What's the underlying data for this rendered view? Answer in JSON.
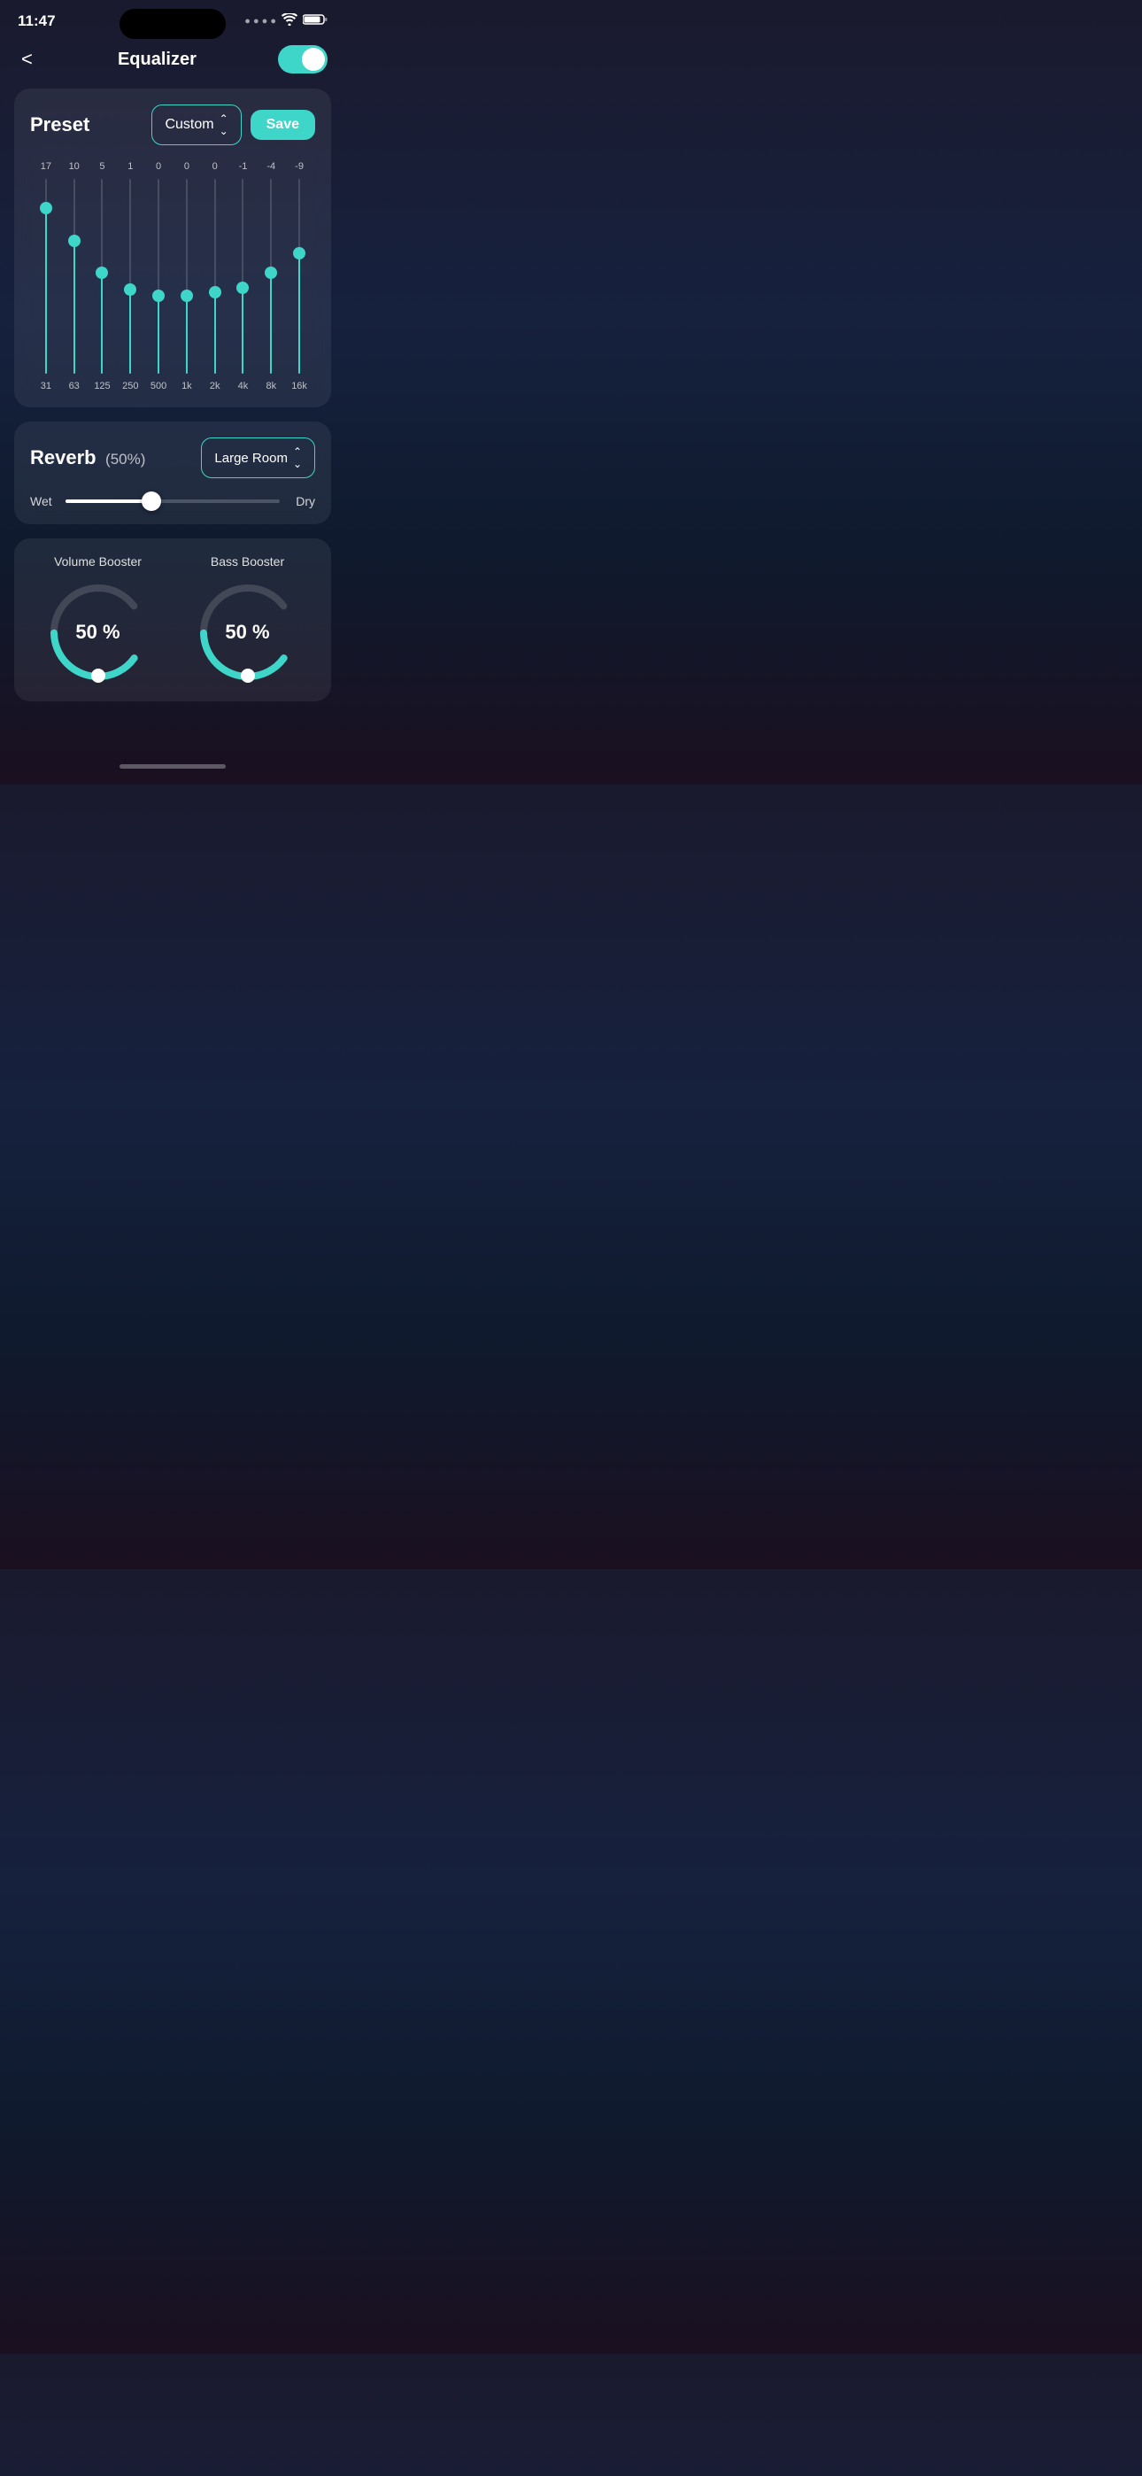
{
  "statusBar": {
    "time": "11:47",
    "signal": "····",
    "wifi": "wifi",
    "battery": "battery"
  },
  "header": {
    "backLabel": "<",
    "title": "Equalizer",
    "toggleOn": true
  },
  "preset": {
    "label": "Preset",
    "dropdownLabel": "Custom",
    "dropdownArrow": "⌃",
    "saveLabel": "Save"
  },
  "eq": {
    "bands": [
      {
        "freq": "31",
        "value": "17",
        "heightPct": 85,
        "thumbPct": 15
      },
      {
        "freq": "63",
        "value": "10",
        "heightPct": 68,
        "thumbPct": 32
      },
      {
        "freq": "125",
        "value": "5",
        "heightPct": 52,
        "thumbPct": 48
      },
      {
        "freq": "250",
        "value": "1",
        "heightPct": 43,
        "thumbPct": 57
      },
      {
        "freq": "500",
        "value": "0",
        "heightPct": 40,
        "thumbPct": 60
      },
      {
        "freq": "1k",
        "value": "0",
        "heightPct": 40,
        "thumbPct": 60
      },
      {
        "freq": "2k",
        "value": "0",
        "heightPct": 42,
        "thumbPct": 58
      },
      {
        "freq": "4k",
        "value": "-1",
        "heightPct": 44,
        "thumbPct": 56
      },
      {
        "freq": "8k",
        "value": "-4",
        "heightPct": 52,
        "thumbPct": 48
      },
      {
        "freq": "16k",
        "value": "-9",
        "heightPct": 62,
        "thumbPct": 38
      }
    ],
    "trackHeight": 220
  },
  "reverb": {
    "title": "Reverb",
    "percentage": "(50%)",
    "dropdownLabel": "Large Room",
    "dropdownArrow": "⌃",
    "wetLabel": "Wet",
    "dryLabel": "Dry",
    "sliderPct": 40
  },
  "volumeBooster": {
    "title": "Volume Booster",
    "value": "50 %",
    "pct": 50
  },
  "bassBooster": {
    "title": "Bass Booster",
    "value": "50 %",
    "pct": 50
  }
}
